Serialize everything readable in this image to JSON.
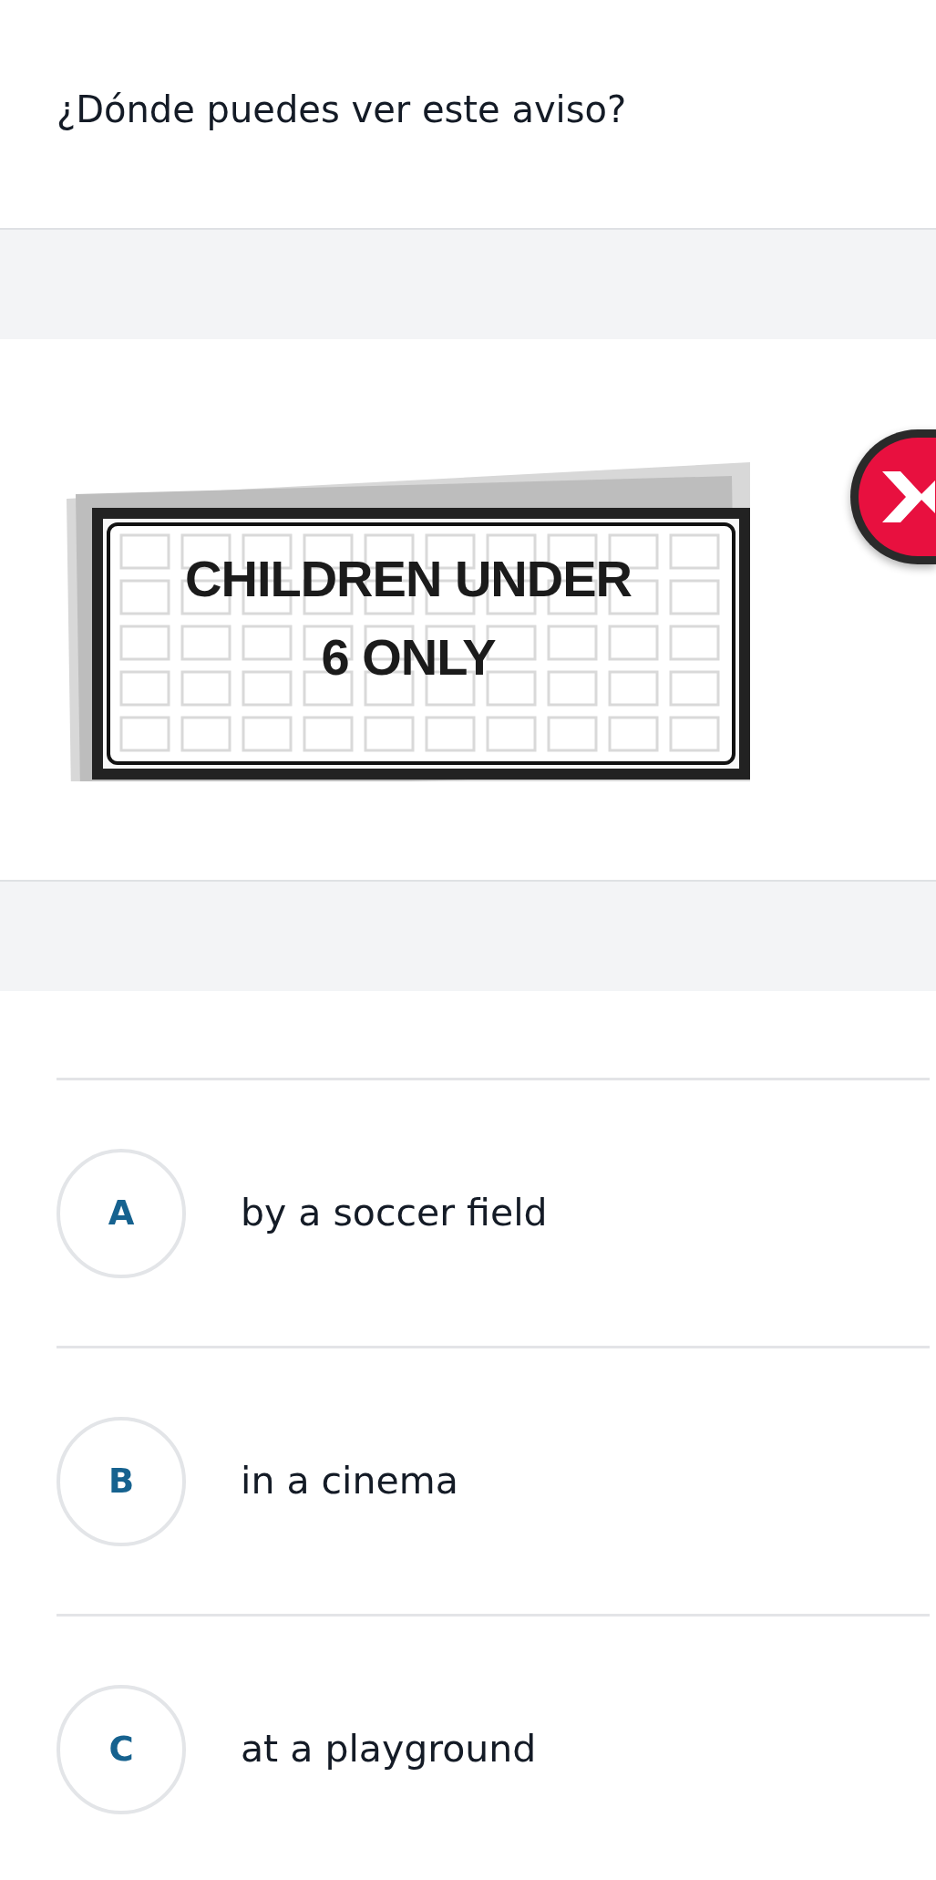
{
  "question": "¿Dónde puedes ver este aviso?",
  "sign": {
    "lines": [
      "CHILDREN UNDER",
      "6 ONLY"
    ]
  },
  "options": [
    {
      "letter": "A",
      "text": "by a soccer field",
      "selected": false
    },
    {
      "letter": "B",
      "text": "in a cinema",
      "selected": false
    },
    {
      "letter": "C",
      "text": "at a playground",
      "selected": false
    }
  ]
}
